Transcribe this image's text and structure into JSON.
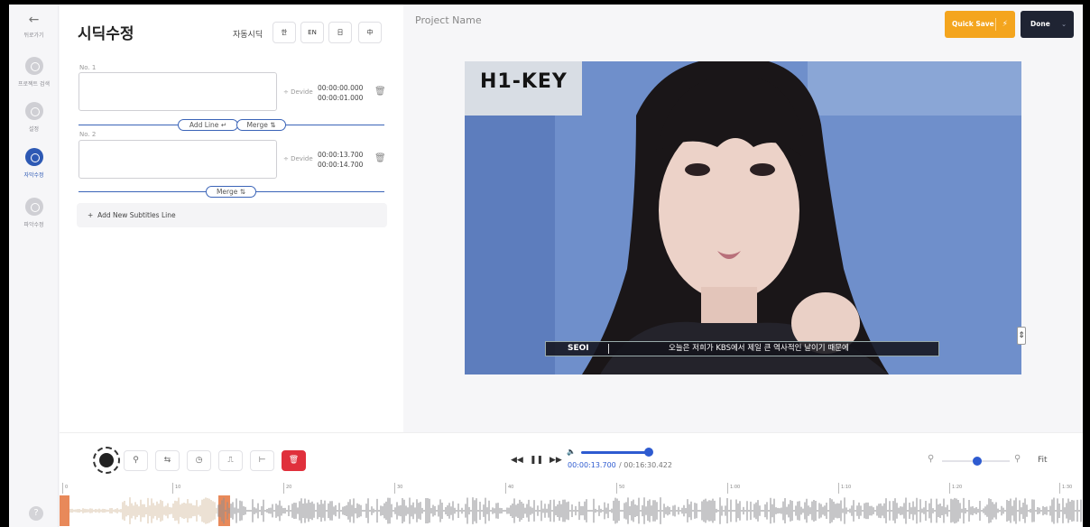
{
  "sidebar": {
    "back_label": "뒤로가기",
    "items": [
      {
        "label": "프로젝트 검색"
      },
      {
        "label": "설정"
      },
      {
        "label": "자막수정"
      },
      {
        "label": "파악수정"
      }
    ],
    "help": "?"
  },
  "subtitle_panel": {
    "title": "시딕수정",
    "auto_label": "자동시딕",
    "languages": [
      "한",
      "EN",
      "日",
      "中"
    ],
    "entries": [
      {
        "no": "No. 1",
        "text": "",
        "divide": "Devide",
        "start": "00:00:00.000",
        "end": "00:00:01.000"
      },
      {
        "no": "No. 2",
        "text": "",
        "divide": "Devide",
        "start": "00:00:13.700",
        "end": "00:00:14.700"
      }
    ],
    "add_line_label": "Add Line",
    "merge_label": "Merge",
    "add_new_label": "Add New Subtitles Line"
  },
  "header": {
    "project_name": "Project Name",
    "quick_save_label": "Quick Save",
    "done_label": "Done"
  },
  "video": {
    "logo": "H1-KEY",
    "caption_speaker": "SEOI",
    "caption_text": "오늘은 저희가 KBS에서 제일 큰 역사적인 날이기 때문에"
  },
  "player": {
    "current_time": "00:00:13.700",
    "total_time": "/ 00:16:30.422",
    "volume": 0.9,
    "zoom": 0.45,
    "fit_label": "Fit"
  },
  "timeline": {
    "ticks": [
      "0",
      "10",
      "20",
      "30",
      "40",
      "50",
      "1:00",
      "1:10",
      "1:20",
      "1:30"
    ]
  },
  "colors": {
    "accent": "#2e5bd0",
    "quick_save": "#f4a51e",
    "done": "#1f2433",
    "delete": "#e0303c",
    "region": "#e8895a"
  }
}
